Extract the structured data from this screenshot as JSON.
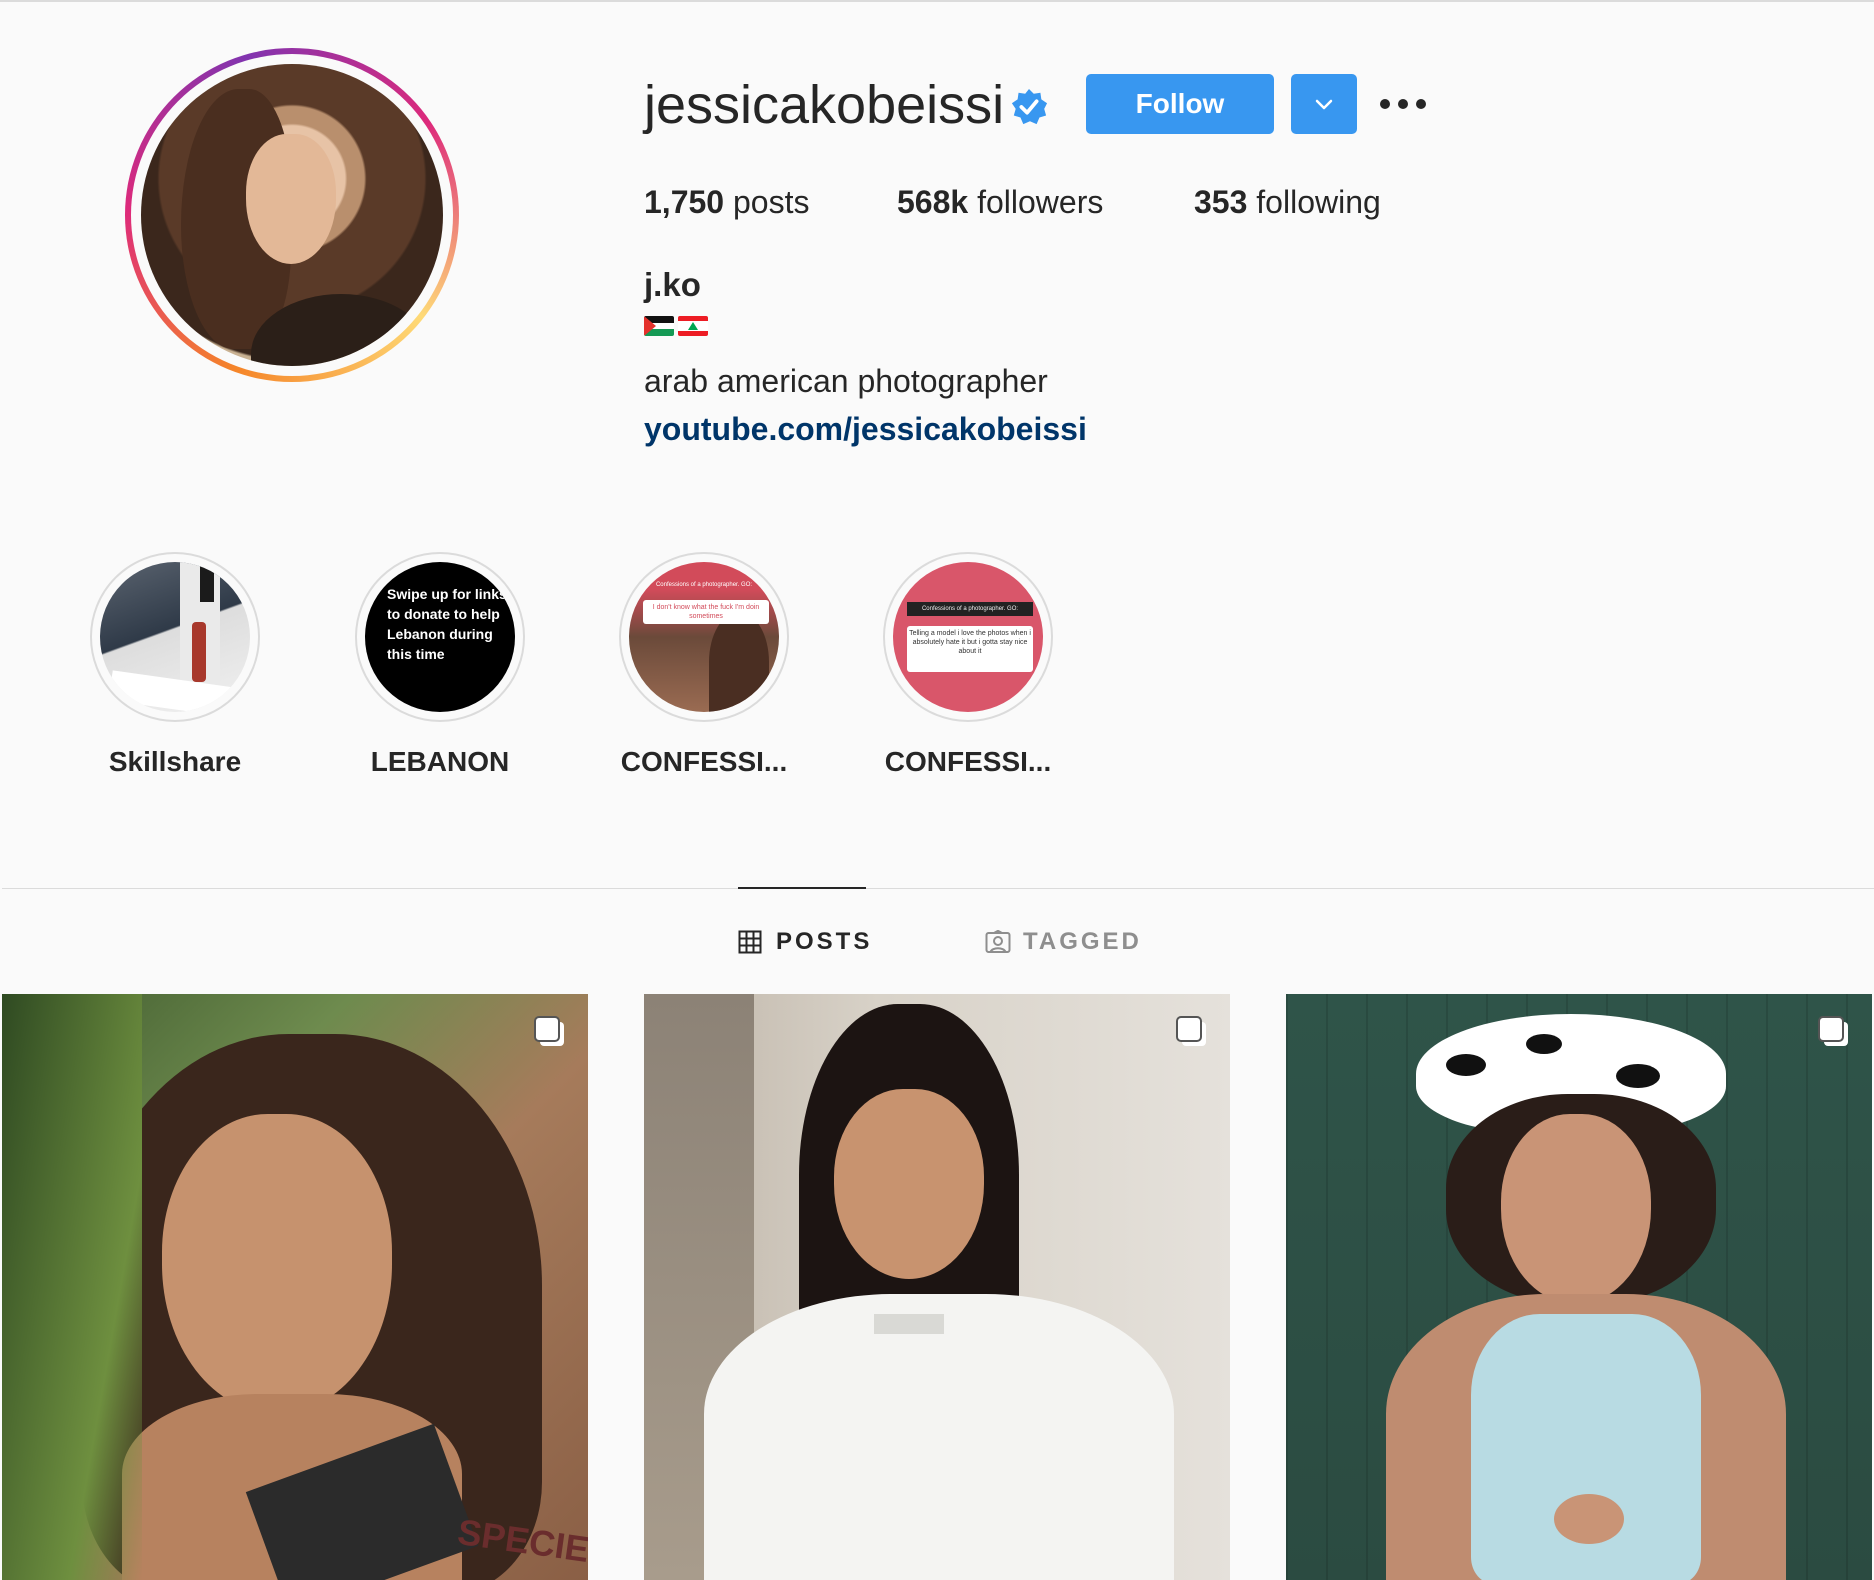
{
  "profile": {
    "username": "jessicakobeissi",
    "verified": true,
    "follow_label": "Follow",
    "stats": {
      "posts_count": "1,750",
      "posts_label": "posts",
      "followers_count": "568k",
      "followers_label": "followers",
      "following_count": "353",
      "following_label": "following"
    },
    "full_name": "j.ko",
    "flags": [
      "palestine-flag",
      "lebanon-flag"
    ],
    "bio": "arab american photographer",
    "link": "youtube.com/jessicakobeissi"
  },
  "highlights": [
    {
      "label": "Skillshare"
    },
    {
      "label": "LEBANON",
      "cover_text": "Swipe up for links to donate to help Lebanon during this time"
    },
    {
      "label": "CONFESSI...",
      "cover_header": "Confessions of a photographer. GO:",
      "cover_text": "I don't know what the fuck I'm doin sometimes"
    },
    {
      "label": "CONFESSI...",
      "cover_header": "Confessions of a photographer. GO:",
      "cover_text": "Telling a model i love the photos when i absolutely hate it but i gotta stay nice about it"
    }
  ],
  "tabs": [
    {
      "label": "POSTS",
      "active": true,
      "icon": "grid-icon"
    },
    {
      "label": "TAGGED",
      "active": false,
      "icon": "tagged-icon"
    }
  ],
  "posts": [
    {
      "type": "carousel",
      "overlay_text": "SPECIESIS"
    },
    {
      "type": "carousel"
    },
    {
      "type": "carousel"
    }
  ],
  "colors": {
    "accent": "#3897f0",
    "link": "#003569",
    "text": "#262626",
    "background": "#fafafa",
    "border": "#dbdbdb"
  }
}
